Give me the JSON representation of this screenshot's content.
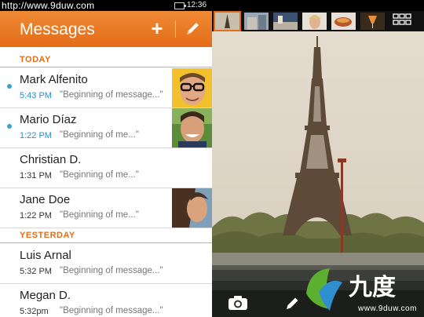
{
  "status_bar": {
    "url": "http://www.9duw.com",
    "time": "12:36"
  },
  "header": {
    "title": "Messages",
    "add_icon": "plus-icon",
    "edit_icon": "pencil-icon"
  },
  "sections": [
    {
      "label": "TODAY"
    },
    {
      "label": "YESTERDAY"
    }
  ],
  "messages": [
    {
      "name": "Mark Alfenito",
      "time": "5:43 PM",
      "preview": "\"Beginning of message...\"",
      "unread": true,
      "avatar": "avatar-glasses"
    },
    {
      "name": "Mario Díaz",
      "time": "1:22 PM",
      "preview": "\"Beginning of me...\"",
      "unread": true,
      "avatar": "avatar-smiling"
    },
    {
      "name": "Christian D.",
      "time": "1:31 PM",
      "preview": "\"Beginning of me...\"",
      "unread": false
    },
    {
      "name": "Jane Doe",
      "time": "1:22 PM",
      "preview": "\"Beginning of me...\"",
      "unread": false,
      "avatar": "avatar-woman"
    },
    {
      "name": "Luis Arnal",
      "time": "5:32 PM",
      "preview": "\"Beginning of message...\"",
      "unread": false
    },
    {
      "name": "Megan D.",
      "time": "5:32pm",
      "preview": "\"Beginning of message...\"",
      "unread": false
    }
  ],
  "gallery": {
    "thumbnails": [
      "eiffel-tower",
      "building",
      "street",
      "portrait",
      "food",
      "drink"
    ],
    "grid_icon": "grid-icon",
    "camera_icon": "camera-icon",
    "edit_icon": "pencil-icon",
    "watermark_url": "www.9duw.com"
  },
  "colors": {
    "accent": "#e36c18",
    "unread": "#36a5d6"
  }
}
